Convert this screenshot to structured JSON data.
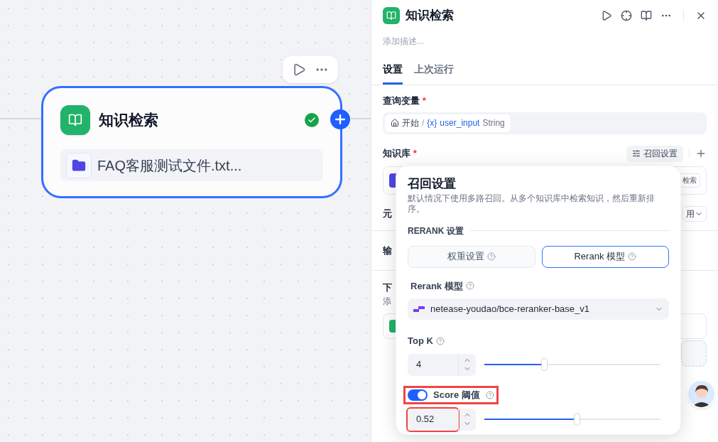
{
  "canvas": {
    "node": {
      "title": "知识检索",
      "file": "FAQ客服测试文件.txt..."
    }
  },
  "panel": {
    "title": "知识检索",
    "description_placeholder": "添加描述...",
    "tabs": [
      {
        "label": "设置",
        "selected": true
      },
      {
        "label": "上次运行",
        "selected": false
      }
    ],
    "query": {
      "label": "查询变量",
      "required": "*",
      "source": "开始",
      "separator": "/",
      "variable_icon": "{x}",
      "variable": "user_input",
      "type": "String"
    },
    "knowledge": {
      "label": "知识库",
      "required": "*",
      "recall_button": "召回设置",
      "item_button": "检索"
    },
    "metadata": {
      "label": "元",
      "select": "用"
    },
    "output": {
      "label": "输"
    },
    "next": {
      "label": "下",
      "hint": "添"
    }
  },
  "popover": {
    "title": "召回设置",
    "description": "默认情况下使用多路召回。从多个知识库中检索知识，然后重新排序。",
    "section": "RERANK 设置",
    "modes": [
      {
        "label": "权重设置",
        "selected": false
      },
      {
        "label": "Rerank 模型",
        "selected": true
      }
    ],
    "model_label": "Rerank 模型",
    "model": "netease-youdao/bce-reranker-base_v1",
    "top_k": {
      "label": "Top K",
      "value": "4",
      "level": 0.34
    },
    "score": {
      "label": "Score 阈值",
      "on": true,
      "value": "0.52",
      "level": 0.525
    }
  }
}
